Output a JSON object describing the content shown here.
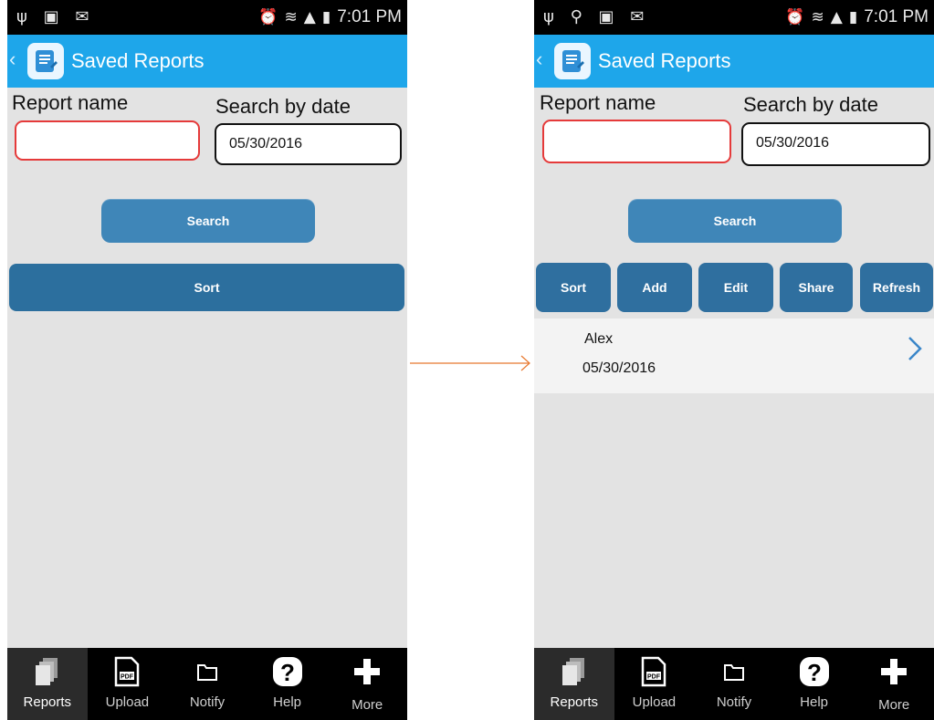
{
  "status": {
    "time": "7:01 PM"
  },
  "app": {
    "title": "Saved Reports",
    "back": "‹"
  },
  "form": {
    "report_name_label": "Report name",
    "search_by_date_label": "Search by date",
    "date_value": "05/30/2016",
    "search_label": "Search"
  },
  "left": {
    "sort_label": "Sort"
  },
  "right": {
    "buttons": [
      "Sort",
      "Add",
      "Edit",
      "Share",
      "Refresh"
    ],
    "report": {
      "name": "Alex",
      "date": "05/30/2016"
    }
  },
  "tabs": [
    {
      "label": "Reports",
      "icon": "reports-icon"
    },
    {
      "label": "Upload",
      "icon": "pdf-icon"
    },
    {
      "label": "Notify",
      "icon": "folder-icon"
    },
    {
      "label": "Help",
      "icon": "help-icon"
    },
    {
      "label": "More",
      "icon": "plus-icon"
    }
  ],
  "colors": {
    "accent": "#1ea6ea",
    "button": "#3f86b8",
    "invalid": "#e53a3a"
  }
}
